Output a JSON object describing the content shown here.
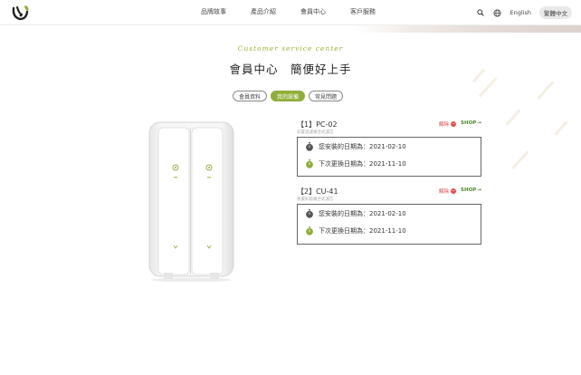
{
  "header": {
    "nav": [
      "品牌故事",
      "產品介紹",
      "會員中心",
      "客戶服務"
    ],
    "lang_en": "English",
    "lang_tc": "繁體中文",
    "icons": [
      "search-icon",
      "globe-icon"
    ]
  },
  "titles": {
    "script": "Customer service center",
    "main": "會員中心　簡便好上手"
  },
  "tabs": [
    {
      "label": "會員資料",
      "active": false
    },
    {
      "label": "我的設備",
      "active": true
    },
    {
      "label": "常見問題",
      "active": false
    }
  ],
  "products": [
    {
      "name": "【1】PC-02",
      "sub": "前置過濾複合式濾芯",
      "unbind": "解除",
      "shop": "SHOP",
      "install_label": "您安裝的日期為：",
      "install_date": "2021-02-10",
      "replace_label": "下次更換日期為：",
      "replace_date": "2021-11-10"
    },
    {
      "name": "【2】CU-41",
      "sub": "後置抑菌複合式濾芯",
      "unbind": "解除",
      "shop": "SHOP",
      "install_label": "您安裝的日期為：",
      "install_date": "2021-02-10",
      "replace_label": "下次更換日期為：",
      "replace_date": "2021-11-10"
    }
  ],
  "colors": {
    "accent_green": "#8fae3a",
    "unbind_red": "#e84c4c",
    "shop_green": "#4f8a2e"
  }
}
